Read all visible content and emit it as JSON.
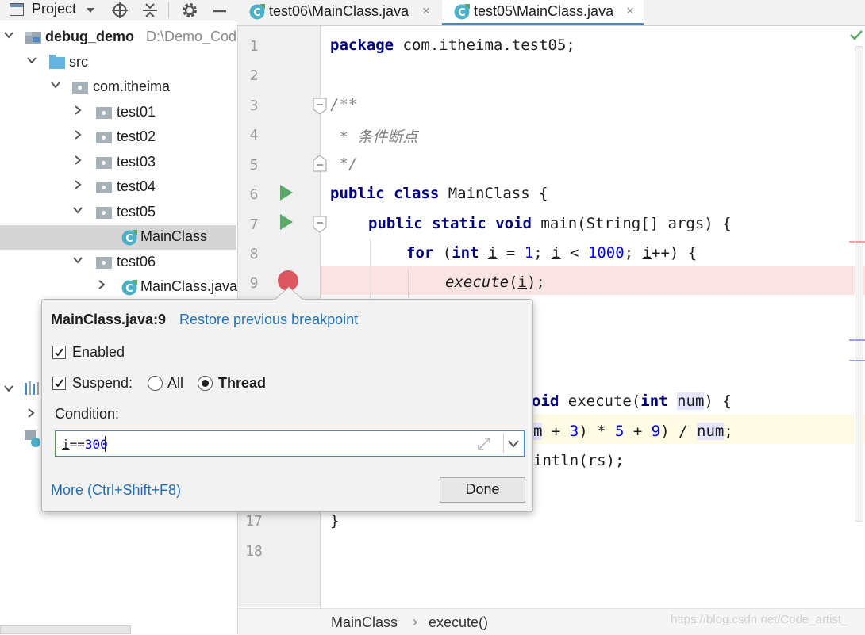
{
  "project_panel": {
    "title": "Project",
    "tree": {
      "project_name": "debug_demo",
      "project_path": "D:\\Demo_Cod",
      "src": "src",
      "package": "com.itheima",
      "folders": [
        "test01",
        "test02",
        "test03",
        "test04",
        "test05"
      ],
      "test05_class": "MainClass",
      "test06": "test06",
      "test06_class": "MainClass.java"
    }
  },
  "tabs": [
    {
      "label": "test06\\MainClass.java",
      "close": "×"
    },
    {
      "label": "test05\\MainClass.java",
      "close": "×"
    }
  ],
  "editor": {
    "line_numbers": [
      "1",
      "2",
      "3",
      "4",
      "5",
      "6",
      "7",
      "8",
      "9",
      "17",
      "18"
    ],
    "code": {
      "l1_kw": "package",
      "l1_rest": " com.itheima.test05;",
      "l3": "/**",
      "l4": " * 条件断点",
      "l5": " */",
      "l6_kw1": "public",
      "l6_kw2": "class",
      "l6_rest": " MainClass {",
      "l7_kw1": "public",
      "l7_kw2": "static",
      "l7_kw3": "void",
      "l7_rest": " main(String[] args) {",
      "l8_kw": "for",
      "l8_open": " (",
      "l8_kw2": "int",
      "l8_i1": "i",
      "l8_eq": " = ",
      "l8_one": "1",
      "l8_semi1": "; ",
      "l8_i2": "i",
      "l8_lt": " < ",
      "l8_1000": "1000",
      "l8_semi2": "; ",
      "l8_i3": "i",
      "l8_end": "++) {",
      "l9_call": "execute",
      "l9_open": "(",
      "l9_i": "i",
      "l9_end": ");",
      "l12_a": "oid",
      "l12_b": " execute(",
      "l12_kw": "int",
      "l12_sp": " ",
      "l12_param": "num",
      "l12_end": ") {",
      "l13_a": "m",
      "l13_b": " + ",
      "l13_3": "3",
      "l13_c": ") * ",
      "l13_5": "5",
      "l13_d": " + ",
      "l13_9": "9",
      "l13_e": ") / ",
      "l13_num": "num",
      "l13_f": ";",
      "l14": "intln(rs);",
      "l17": "}"
    }
  },
  "breadcrumb": {
    "item1": "MainClass",
    "sep": "›",
    "item2": "execute()"
  },
  "watermark": "https://blog.csdn.net/Code_artist_",
  "popup": {
    "title": "MainClass.java:9",
    "restore_link": "Restore previous breakpoint",
    "enabled_label": "Enabled",
    "enabled_checked": true,
    "suspend_label": "Suspend:",
    "suspend_checked": true,
    "all_label": "All",
    "thread_label": "Thread",
    "suspend_policy": "Thread",
    "condition_label": "Condition:",
    "condition_value_var": "i",
    "condition_value_op": "==",
    "condition_value_num": "300",
    "more_link": "More (Ctrl+Shift+F8)",
    "done_label": "Done"
  },
  "colors": {
    "accent": "#4a86c8",
    "link": "#2470b3",
    "breakpoint": "#db5860",
    "run": "#59a869"
  }
}
